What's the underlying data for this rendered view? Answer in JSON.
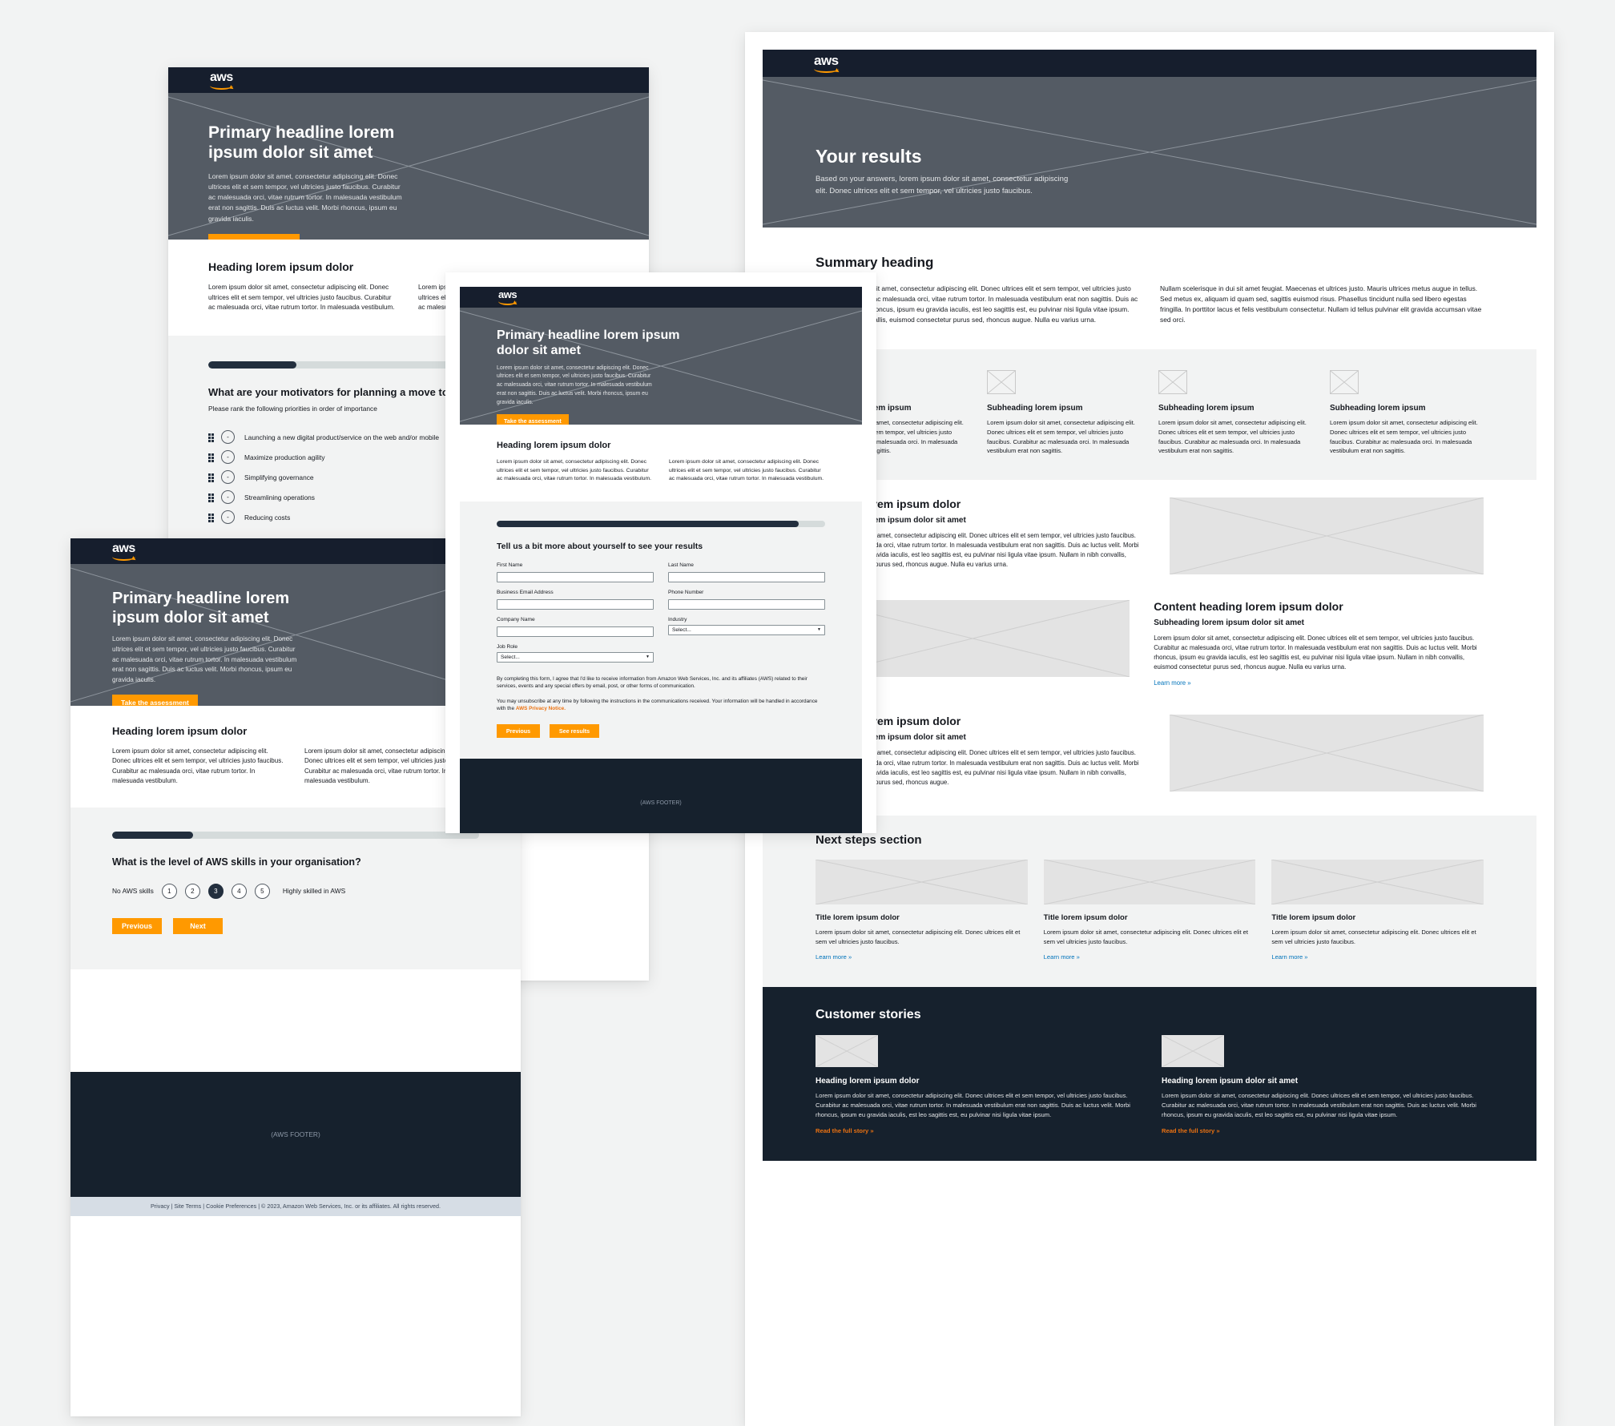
{
  "brand": {
    "logo_text": "aws",
    "accent": "#ff9900",
    "dark": "#161e2d",
    "hero_bg": "#545b64"
  },
  "hero": {
    "headline": "Primary headline lorem ipsum dolor sit amet",
    "body": "Lorem ipsum dolor sit amet, consectetur adipiscing elit. Donec ultrices elit et sem tempor, vel ultricies justo faucibus. Curabitur ac malesuada orci, vitae rutrum tortor. In malesuada vestibulum erat non sagittis. Duis ac luctus velit. Morbi rhoncus, ipsum eu gravida iaculis.",
    "cta": "Take the assessment"
  },
  "intro": {
    "heading": "Heading lorem ipsum dolor",
    "col1": "Lorem ipsum dolor sit amet, consectetur adipiscing elit. Donec ultrices elit et sem tempor, vel ultricies justo faucibus. Curabitur ac malesuada orci, vitae rutrum tortor. In malesuada vestibulum.",
    "col2": "Lorem ipsum dolor sit amet, consectetur adipiscing elit. Donec ultrices elit et sem tempor, vel ultricies justo faucibus. Curabitur ac malesuada orci, vitae rutrum tortor. In malesuada vestibulum."
  },
  "question_rank": {
    "progress_percent": 22,
    "title": "What are your motivators for planning a move to the cloud?",
    "subtitle": "Please rank the following priorities in order of importance",
    "rank_placeholder": "-",
    "items": [
      "Launching a new digital product/service on the web and/or mobile",
      "Maximize production agility",
      "Simplifying governance",
      "Streamlining operations",
      "Reducing costs"
    ],
    "prev_label": "Previous",
    "next_label": "Next"
  },
  "question_scale": {
    "progress_percent": 22,
    "title": "What is the level of AWS skills in your organisation?",
    "min_label": "No AWS skills",
    "max_label": "Highly skilled in AWS",
    "options": [
      "1",
      "2",
      "3",
      "4",
      "5"
    ],
    "selected": "3",
    "prev_label": "Previous",
    "next_label": "Next"
  },
  "form": {
    "progress_percent": 92,
    "title": "Tell us a bit more about yourself to see your results",
    "fields": [
      {
        "label": "First Name",
        "type": "text",
        "value": ""
      },
      {
        "label": "Last Name",
        "type": "text",
        "value": ""
      },
      {
        "label": "Business Email Address",
        "type": "text",
        "value": ""
      },
      {
        "label": "Phone Number",
        "type": "text",
        "value": ""
      },
      {
        "label": "Company Name",
        "type": "text",
        "value": ""
      },
      {
        "label": "Industry",
        "type": "select",
        "value": "Select..."
      },
      {
        "label": "Job Role",
        "type": "select",
        "value": "Select..."
      }
    ],
    "legal_1": "By completing this form, I agree that I'd like to receive information from Amazon Web Services, Inc. and its affiliates (AWS) related to their services, events and any special offers by email, post, or other forms of communication.",
    "legal_2": "You may unsubscribe at any time by following the instructions in the communications received. Your information will be handled in accordance with the",
    "legal_link": "AWS Privacy Notice.",
    "prev_label": "Previous",
    "submit_label": "See results"
  },
  "footer": {
    "placeholder": "(AWS FOOTER)",
    "legal_bar": "Privacy | Site Terms | Cookie Preferences | © 2023, Amazon Web Services, Inc. or its affiliates. All rights reserved."
  },
  "results": {
    "hero_title": "Your results",
    "hero_body": "Based on your answers, lorem ipsum dolor sit amet, consectetur adipiscing elit. Donec ultrices elit et sem tempor, vel ultricies justo faucibus.",
    "summary_heading": "Summary heading",
    "summary_col1": "Lorem ipsum dolor sit amet, consectetur adipiscing elit. Donec ultrices elit et sem tempor, vel ultricies justo faucibus. Curabitur ac malesuada orci, vitae rutrum tortor. In malesuada vestibulum erat non sagittis. Duis ac luctus velit. Morbi rhoncus, ipsum eu gravida iaculis, est leo sagittis est, eu pulvinar nisi ligula vitae ipsum. Nullam in nibh convallis, euismod consectetur purus sed, rhoncus augue. Nulla eu varius urna.",
    "summary_col2": "Nullam scelerisque in dui sit amet feugiat. Maecenas et ultrices justo. Mauris ultrices metus augue in tellus. Sed metus ex, aliquam id quam sed, sagittis euismod risus. Phasellus tincidunt nulla sed libero egestas fringilla. In porttitor lacus et felis vestibulum consectetur. Nullam id tellus pulvinar elit gravida accumsan vitae sed orci.",
    "cards": [
      {
        "title": "Subheading lorem ipsum",
        "body": "Lorem ipsum dolor sit amet, consectetur adipiscing elit. Donec ultrices elit et sem tempor, vel ultricies justo faucibus. Curabitur ac malesuada orci. In malesuada vestibulum erat non sagittis."
      },
      {
        "title": "Subheading lorem ipsum",
        "body": "Lorem ipsum dolor sit amet, consectetur adipiscing elit. Donec ultrices elit et sem tempor, vel ultricies justo faucibus. Curabitur ac malesuada orci. In malesuada vestibulum erat non sagittis."
      },
      {
        "title": "Subheading lorem ipsum",
        "body": "Lorem ipsum dolor sit amet, consectetur adipiscing elit. Donec ultrices elit et sem tempor, vel ultricies justo faucibus. Curabitur ac malesuada orci. In malesuada vestibulum erat non sagittis."
      },
      {
        "title": "Subheading lorem ipsum",
        "body": "Lorem ipsum dolor sit amet, consectetur adipiscing elit. Donec ultrices elit et sem tempor, vel ultricies justo faucibus. Curabitur ac malesuada orci. In malesuada vestibulum erat non sagittis."
      }
    ],
    "feature_1": {
      "heading": "Heading lorem ipsum dolor",
      "subheading": "Subheading lorem ipsum dolor sit amet",
      "body": "Lorem ipsum dolor sit amet, consectetur adipiscing elit. Donec ultrices elit et sem tempor, vel ultricies justo faucibus. Curabitur ac malesuada orci, vitae rutrum tortor. In malesuada vestibulum erat non sagittis. Duis ac luctus velit. Morbi rhoncus, ipsum eu gravida iaculis, est leo sagittis est, eu pulvinar nisi ligula vitae ipsum. Nullam in nibh convallis, euismod consectetur purus sed, rhoncus augue. Nulla eu varius urna."
    },
    "feature_2": {
      "heading": "Content heading lorem ipsum dolor",
      "subheading": "Subheading lorem ipsum dolor sit amet",
      "body": "Lorem ipsum dolor sit amet, consectetur adipiscing elit. Donec ultrices elit et sem tempor, vel ultricies justo faucibus. Curabitur ac malesuada orci, vitae rutrum tortor. In malesuada vestibulum erat non sagittis. Duis ac luctus velit. Morbi rhoncus, ipsum eu gravida iaculis, est leo sagittis est, eu pulvinar nisi ligula vitae ipsum. Nullam in nibh convallis, euismod consectetur purus sed, rhoncus augue. Nulla eu varius urna.",
      "link": "Learn more »"
    },
    "feature_3": {
      "heading": "Heading lorem ipsum dolor",
      "subheading": "Subheading lorem ipsum dolor sit amet",
      "body": "Lorem ipsum dolor sit amet, consectetur adipiscing elit. Donec ultrices elit et sem tempor, vel ultricies justo faucibus. Curabitur ac malesuada orci, vitae rutrum tortor. In malesuada vestibulum erat non sagittis. Duis ac luctus velit. Morbi rhoncus, ipsum eu gravida iaculis, est leo sagittis est, eu pulvinar nisi ligula vitae ipsum. Nullam in nibh convallis, euismod consectetur purus sed, rhoncus augue."
    },
    "next_section_heading": "Next steps section",
    "tiles": [
      {
        "title": "Title lorem ipsum dolor",
        "body": "Lorem ipsum dolor sit amet, consectetur adipiscing elit. Donec ultrices elit et sem vel ultricies justo faucibus.",
        "link": "Learn more »"
      },
      {
        "title": "Title lorem ipsum dolor",
        "body": "Lorem ipsum dolor sit amet, consectetur adipiscing elit. Donec ultrices elit et sem vel ultricies justo faucibus.",
        "link": "Learn more »"
      },
      {
        "title": "Title lorem ipsum dolor",
        "body": "Lorem ipsum dolor sit amet, consectetur adipiscing elit. Donec ultrices elit et sem vel ultricies justo faucibus.",
        "link": "Learn more »"
      }
    ],
    "stories_heading": "Customer stories",
    "stories": [
      {
        "title": "Heading lorem ipsum dolor",
        "body": "Lorem ipsum dolor sit amet, consectetur adipiscing elit. Donec ultrices elit et sem tempor, vel ultricies justo faucibus. Curabitur ac malesuada orci, vitae rutrum tortor. In malesuada vestibulum erat non sagittis. Duis ac luctus velit. Morbi rhoncus, ipsum eu gravida iaculis, est leo sagittis est, eu pulvinar nisi ligula vitae ipsum.",
        "link": "Read the full story »"
      },
      {
        "title": "Heading lorem ipsum dolor sit amet",
        "body": "Lorem ipsum dolor sit amet, consectetur adipiscing elit. Donec ultrices elit et sem tempor, vel ultricies justo faucibus. Curabitur ac malesuada orci, vitae rutrum tortor. In malesuada vestibulum erat non sagittis. Duis ac luctus velit. Morbi rhoncus, ipsum eu gravida iaculis, est leo sagittis est, eu pulvinar nisi ligula vitae ipsum.",
        "link": "Read the full story »"
      }
    ]
  }
}
